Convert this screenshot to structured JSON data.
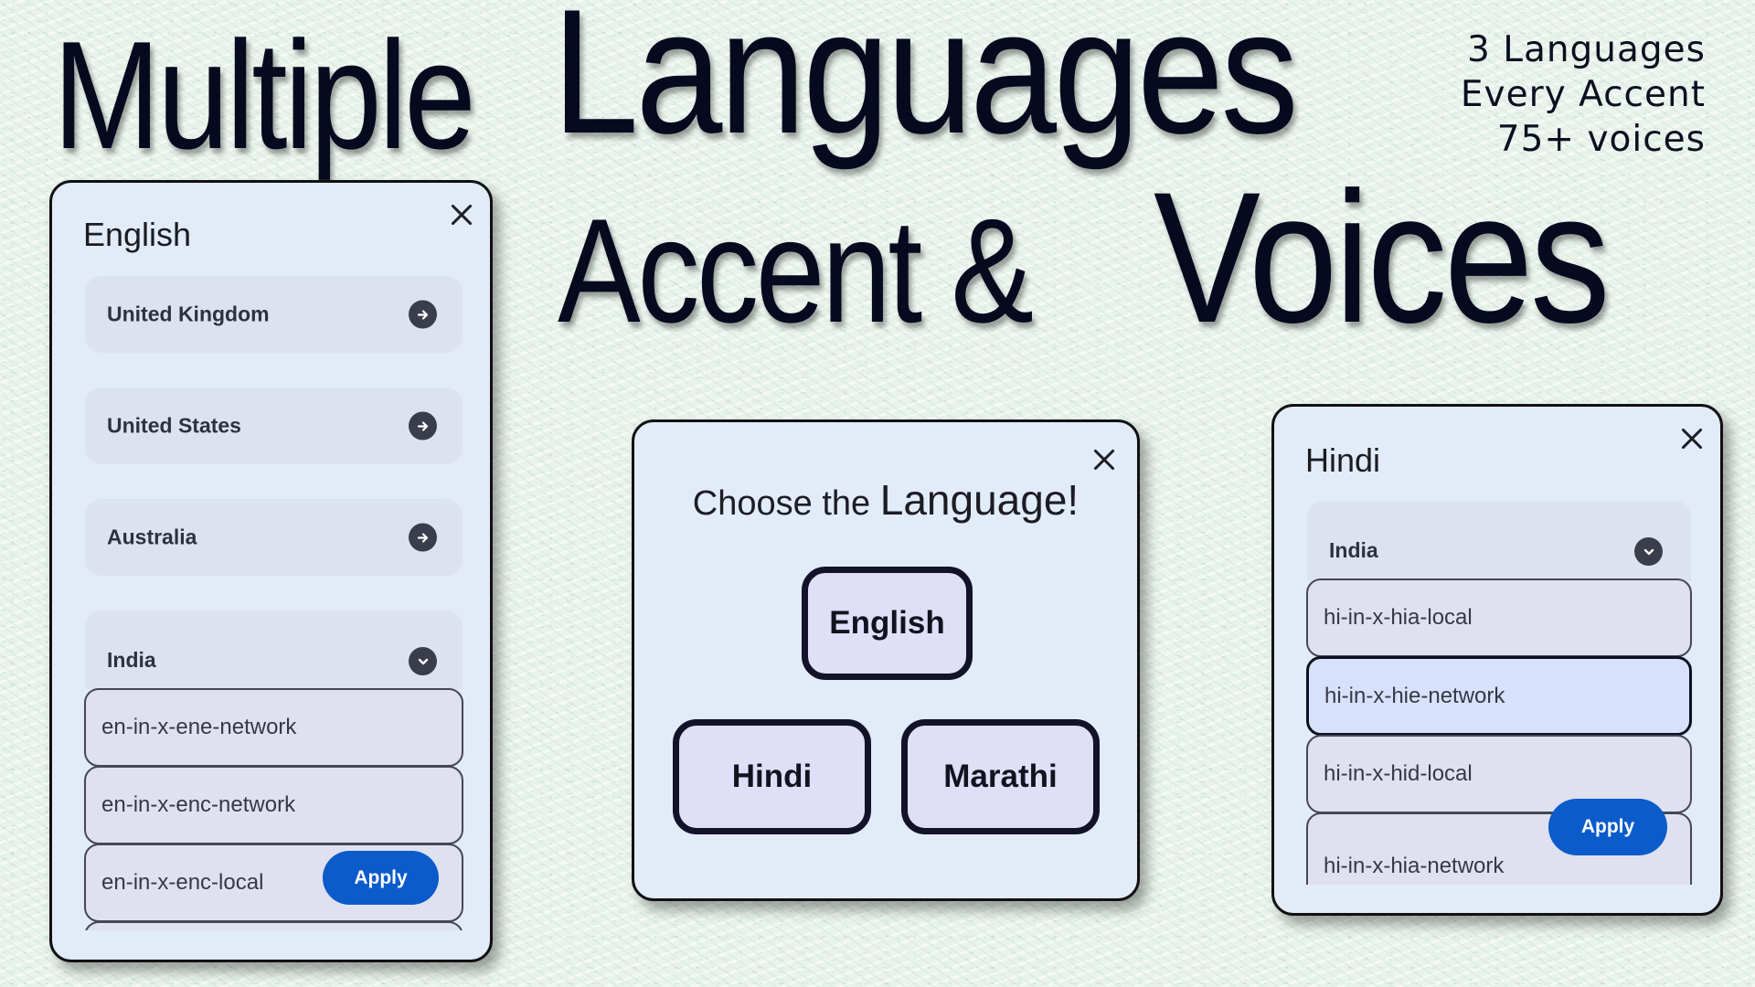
{
  "headline": {
    "word1": "Multiple",
    "word2": "Languages",
    "word3": "Accent &",
    "word4": "Voices"
  },
  "tagline": [
    "3 Languages",
    "Every Accent",
    "75+ voices"
  ],
  "english_panel": {
    "title": "English",
    "regions": [
      {
        "label": "United Kingdom",
        "icon": "arrow-right-icon",
        "expanded": false
      },
      {
        "label": "United States",
        "icon": "arrow-right-icon",
        "expanded": false
      },
      {
        "label": "Australia",
        "icon": "arrow-right-icon",
        "expanded": false
      },
      {
        "label": "India",
        "icon": "chevron-down-icon",
        "expanded": true
      }
    ],
    "voices": [
      "en-in-x-ene-network",
      "en-in-x-enc-network",
      "en-in-x-enc-local"
    ],
    "apply_label": "Apply"
  },
  "choose_panel": {
    "title_part1": "Choose the",
    "title_part2": "Language!",
    "buttons": [
      "English",
      "Hindi",
      "Marathi"
    ]
  },
  "hindi_panel": {
    "title": "Hindi",
    "region": {
      "label": "India",
      "icon": "chevron-down-icon",
      "expanded": true
    },
    "voices": [
      "hi-in-x-hia-local",
      "hi-in-x-hie-network",
      "hi-in-x-hid-local",
      "hi-in-x-hia-network"
    ],
    "selected_voice": "hi-in-x-hie-network",
    "apply_label": "Apply"
  },
  "colors": {
    "apply_blue": "#0b5bcb",
    "panel_bg": "#e2ebf8",
    "row_bg": "#dde2f1",
    "selected_row_bg": "#d8e1fb",
    "headline": "#060a1e",
    "background": "#e9f3ec"
  }
}
